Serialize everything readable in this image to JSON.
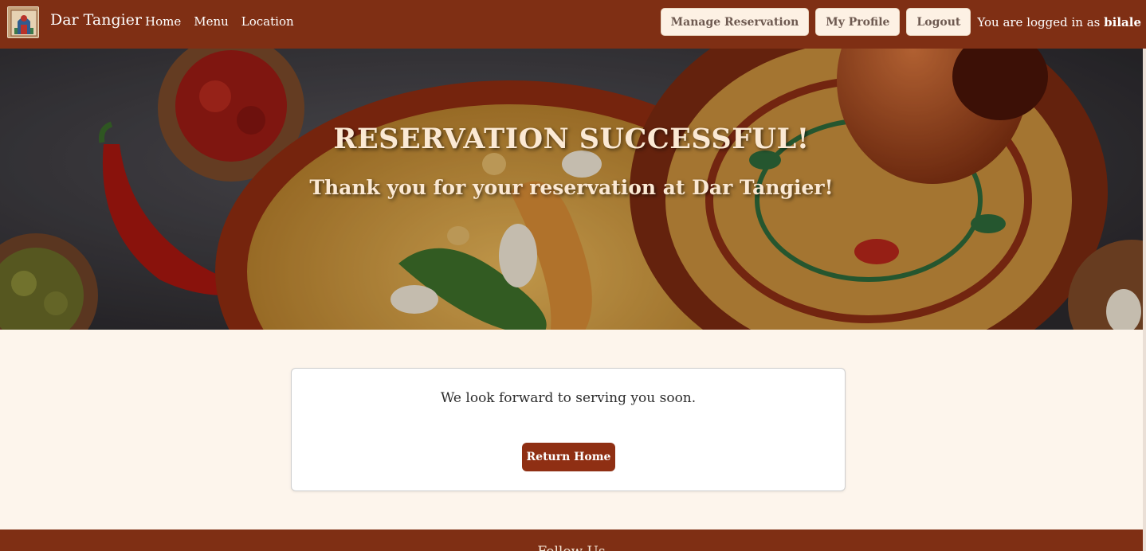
{
  "navbar": {
    "brand_name": "Dar Tangier",
    "links": [
      "Home",
      "Menu",
      "Location"
    ],
    "buttons": {
      "manage_reservation": "Manage Reservation",
      "my_profile": "My Profile",
      "logout": "Logout"
    },
    "logged_in_prefix": "You are logged in as",
    "username": "bilale"
  },
  "hero": {
    "title": "RESERVATION SUCCESSFUL!",
    "subtitle": "Thank you for your reservation at Dar Tangier!"
  },
  "card": {
    "message": "We look forward to serving you soon.",
    "return_button": "Return Home"
  },
  "footer": {
    "title": "Follow Us"
  },
  "colors": {
    "brand": "#7f2f14",
    "button_primary": "#8f2f13",
    "page_background": "#fdf5ec"
  }
}
